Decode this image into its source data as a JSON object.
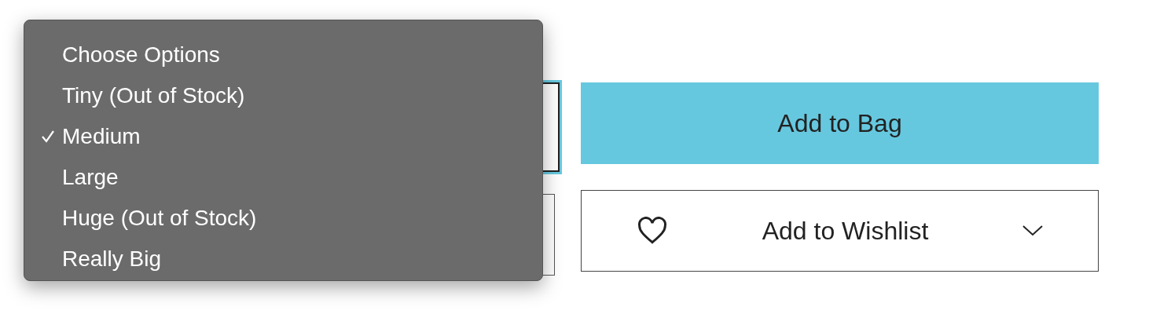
{
  "dropdown": {
    "options": [
      {
        "label": "Choose Options",
        "selected": false
      },
      {
        "label": "Tiny (Out of Stock)",
        "selected": false
      },
      {
        "label": "Medium",
        "selected": true
      },
      {
        "label": "Large",
        "selected": false
      },
      {
        "label": "Huge (Out of Stock)",
        "selected": false
      },
      {
        "label": "Really Big",
        "selected": false
      }
    ]
  },
  "add_to_bag": {
    "label": "Add to Bag"
  },
  "wishlist": {
    "label": "Add to Wishlist"
  }
}
